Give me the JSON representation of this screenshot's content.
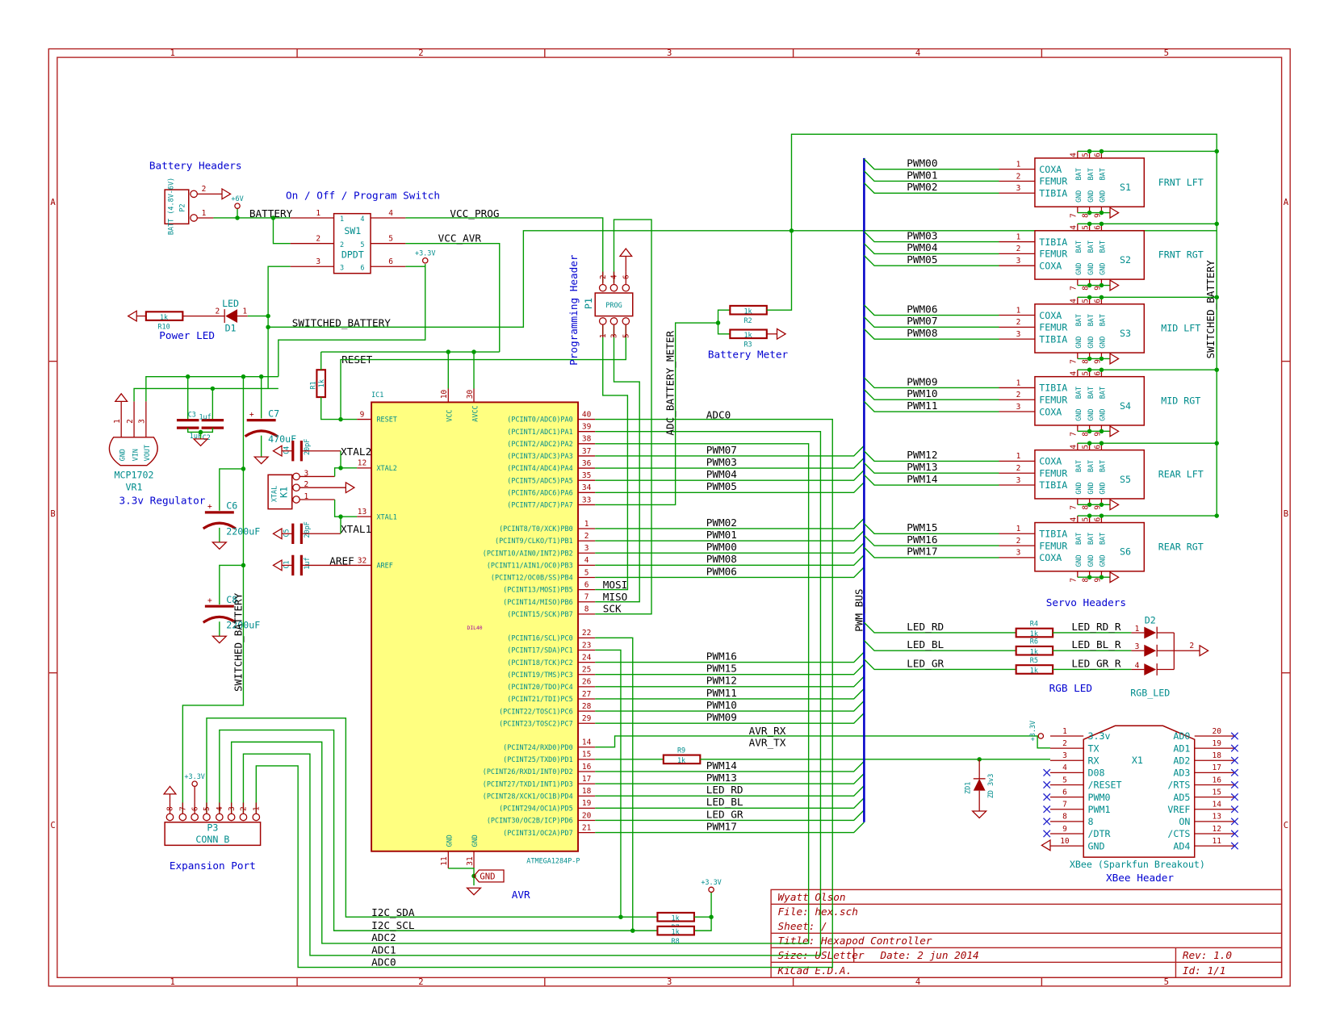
{
  "frame": {
    "cols": [
      "1",
      "2",
      "3",
      "4",
      "5"
    ],
    "rows": [
      "A",
      "B",
      "C"
    ]
  },
  "title_block": {
    "author": "Wyatt Olson",
    "file": "File: hex.sch",
    "sheet": "Sheet: /",
    "title": "Title: Hexapod Controller",
    "size": "Size: USLetter",
    "date": "Date: 2 jun 2014",
    "rev": "Rev: 1.0",
    "tool": "KiCad E.D.A.",
    "id": "Id: 1/1"
  },
  "notes": {
    "battery_headers": "Battery Headers",
    "switch": "On / Off / Program Switch",
    "power_led": "Power LED",
    "regulator": "3.3v Regulator",
    "prog_header": "Programming Header",
    "battery_meter": "Battery Meter",
    "servo_headers": "Servo Headers",
    "rgb_led": "RGB LED",
    "expansion": "Expansion Port",
    "avr": "AVR",
    "xbee": "XBee Header"
  },
  "nets": {
    "battery": "BATTERY",
    "vcc_prog": "VCC_PROG",
    "vcc_avr": "VCC_AVR",
    "switched_battery": "SWITCHED_BATTERY",
    "reset": "RESET",
    "xtal2": "XTAL2",
    "xtal1": "XTAL1",
    "aref": "AREF",
    "adc_battery_meter": "ADC_BATTERY_METER",
    "pwm_bus": "PWM_BUS",
    "i2c_sda": "I2C_SDA",
    "i2c_scl": "I2C_SCL",
    "adc2": "ADC2",
    "adc1": "ADC1",
    "adc0": "ADC0",
    "avr_rx": "AVR_RX",
    "avr_tx": "AVR_TX",
    "gnd": "GND"
  },
  "power": {
    "p6v": "+6V",
    "p33": "+3.3V"
  },
  "components": {
    "p2": {
      "ref": "P2",
      "value": "BATT (4.8V-6V)",
      "pins": [
        "2",
        "1"
      ]
    },
    "sw1": {
      "ref": "SW1",
      "value": "DPDT",
      "pins": [
        "1",
        "2",
        "3",
        "4",
        "5",
        "6"
      ]
    },
    "d1": {
      "ref": "D1",
      "value": "LED",
      "pins": [
        "2",
        "1"
      ]
    },
    "r10": {
      "ref": "R10",
      "value": "1k"
    },
    "r1": {
      "ref": "R1",
      "value": "1k"
    },
    "r2": {
      "ref": "R2",
      "value": "1k"
    },
    "r3": {
      "ref": "R3",
      "value": "1k"
    },
    "r7": {
      "ref": "R7",
      "value": "1k"
    },
    "r8": {
      "ref": "R8",
      "value": "1k"
    },
    "r9": {
      "ref": "R9",
      "value": "1k"
    },
    "vr1": {
      "ref": "VR1",
      "value": "MCP1702",
      "pins": [
        "1",
        "2",
        "3"
      ],
      "pin_names": [
        "GND",
        "VIN",
        "VOUT"
      ]
    },
    "c1": {
      "ref": "C1",
      "value": "1uf"
    },
    "c2": {
      "ref": "C2",
      "value": "1uF"
    },
    "c3": {
      "ref": "C3",
      "value": "1uf"
    },
    "c4": {
      "ref": "C4",
      "value": "20pF"
    },
    "c5": {
      "ref": "C5",
      "value": "20pF"
    },
    "c6": {
      "ref": "C6",
      "value": "2200uF"
    },
    "c7": {
      "ref": "C7",
      "value": "470uF"
    },
    "c8": {
      "ref": "C8",
      "value": "2200uF"
    },
    "k1": {
      "ref": "K1",
      "value": "XTAL",
      "pins": [
        "3",
        "2",
        "1"
      ]
    },
    "p1": {
      "ref": "P1",
      "value": "PROG",
      "pins_top": [
        "2",
        "4",
        "6"
      ],
      "pins_bottom": [
        "1",
        "3",
        "5"
      ]
    },
    "p3": {
      "ref": "P3",
      "value": "CONN_B",
      "pins": [
        "8",
        "7",
        "6",
        "5",
        "4",
        "3",
        "2",
        "1"
      ]
    },
    "zd1": {
      "ref": "ZD1",
      "value": "ZD 3v3"
    },
    "d2": {
      "ref": "D2",
      "value": "RGB_LED",
      "pins": [
        "1",
        "3",
        "4",
        "2"
      ]
    }
  },
  "ic": {
    "ref": "IC1",
    "value": "ATMEGA1284P-P",
    "package": "DIL40",
    "top_pins": [
      {
        "n": "10",
        "name": "VCC"
      },
      {
        "n": "30",
        "name": "AVCC"
      }
    ],
    "bottom_pins": [
      {
        "n": "11",
        "name": "GND"
      },
      {
        "n": "31",
        "name": "GND"
      }
    ],
    "left_pins": [
      {
        "n": "9",
        "name": "RESET"
      },
      {
        "n": "12",
        "name": "XTAL2"
      },
      {
        "n": "13",
        "name": "XTAL1"
      },
      {
        "n": "32",
        "name": "AREF"
      }
    ],
    "right_pins": [
      {
        "n": "40",
        "name": "(PCINT0/ADC0)PA0",
        "net": "ADC0"
      },
      {
        "n": "39",
        "name": "(PCINT1/ADC1)PA1",
        "net": ""
      },
      {
        "n": "38",
        "name": "(PCINT2/ADC2)PA2",
        "net": ""
      },
      {
        "n": "37",
        "name": "(PCINT3/ADC3)PA3",
        "net": "PWM07"
      },
      {
        "n": "36",
        "name": "(PCINT4/ADC4)PA4",
        "net": "PWM03"
      },
      {
        "n": "35",
        "name": "(PCINT5/ADC5)PA5",
        "net": "PWM04"
      },
      {
        "n": "34",
        "name": "(PCINT6/ADC6)PA6",
        "net": "PWM05"
      },
      {
        "n": "33",
        "name": "(PCINT7/ADC7)PA7",
        "net": ""
      },
      {
        "n": "1",
        "name": "(PCINT8/T0/XCK)PB0",
        "net": "PWM02"
      },
      {
        "n": "2",
        "name": "(PCINT9/CLKO/T1)PB1",
        "net": "PWM01"
      },
      {
        "n": "3",
        "name": "(PCINT10/AIN0/INT2)PB2",
        "net": "PWM00"
      },
      {
        "n": "4",
        "name": "(PCINT11/AIN1/OC0)PB3",
        "net": "PWM08"
      },
      {
        "n": "5",
        "name": "(PCINT12/OC0B/SS)PB4",
        "net": "PWM06"
      },
      {
        "n": "6",
        "name": "(PCINT13/MOSI)PB5",
        "net": "MOSI"
      },
      {
        "n": "7",
        "name": "(PCINT14/MISO)PB6",
        "net": "MISO"
      },
      {
        "n": "8",
        "name": "(PCINT15/SCK)PB7",
        "net": "SCK"
      },
      {
        "n": "22",
        "name": "(PCINT16/SCL)PC0",
        "net": ""
      },
      {
        "n": "23",
        "name": "(PCINT17/SDA)PC1",
        "net": ""
      },
      {
        "n": "24",
        "name": "(PCINT18/TCK)PC2",
        "net": "PWM16"
      },
      {
        "n": "25",
        "name": "(PCINT19/TMS)PC3",
        "net": "PWM15"
      },
      {
        "n": "26",
        "name": "(PCINT20/TDO)PC4",
        "net": "PWM12"
      },
      {
        "n": "27",
        "name": "(PCINT21/TDI)PC5",
        "net": "PWM11"
      },
      {
        "n": "28",
        "name": "(PCINT22/TOSC1)PC6",
        "net": "PWM10"
      },
      {
        "n": "29",
        "name": "(PCINT23/TOSC2)PC7",
        "net": "PWM09"
      },
      {
        "n": "14",
        "name": "(PCINT24/RXD0)PD0",
        "net": ""
      },
      {
        "n": "15",
        "name": "(PCINT25/TXD0)PD1",
        "net": ""
      },
      {
        "n": "16",
        "name": "(PCINT26/RXD1/INT0)PD2",
        "net": "PWM14"
      },
      {
        "n": "17",
        "name": "(PCINT27/TXD1/INT1)PD3",
        "net": "PWM13"
      },
      {
        "n": "18",
        "name": "(PCINT28/XCK1/OC1B)PD4",
        "net": "LED_RD"
      },
      {
        "n": "19",
        "name": "(PCINT294/OC1A)PD5",
        "net": "LED_BL"
      },
      {
        "n": "20",
        "name": "(PCINT30/OC2B/ICP)PD6",
        "net": "LED_GR"
      },
      {
        "n": "21",
        "name": "(PCINT31/OC2A)PD7",
        "net": "PWM17"
      }
    ]
  },
  "servos": [
    {
      "ref": "S1",
      "name": "FRNT LFT",
      "joints": [
        "COXA",
        "FEMUR",
        "TIBIA"
      ],
      "nets": [
        "PWM00",
        "PWM01",
        "PWM02"
      ]
    },
    {
      "ref": "S2",
      "name": "FRNT RGT",
      "joints": [
        "TIBIA",
        "FEMUR",
        "COXA"
      ],
      "nets": [
        "PWM03",
        "PWM04",
        "PWM05"
      ]
    },
    {
      "ref": "S3",
      "name": "MID LFT",
      "joints": [
        "COXA",
        "FEMUR",
        "TIBIA"
      ],
      "nets": [
        "PWM06",
        "PWM07",
        "PWM08"
      ]
    },
    {
      "ref": "S4",
      "name": "MID RGT",
      "joints": [
        "TIBIA",
        "FEMUR",
        "COXA"
      ],
      "nets": [
        "PWM09",
        "PWM10",
        "PWM11"
      ]
    },
    {
      "ref": "S5",
      "name": "REAR LFT",
      "joints": [
        "COXA",
        "FEMUR",
        "TIBIA"
      ],
      "nets": [
        "PWM12",
        "PWM13",
        "PWM14"
      ]
    },
    {
      "ref": "S6",
      "name": "REAR RGT",
      "joints": [
        "TIBIA",
        "FEMUR",
        "COXA"
      ],
      "nets": [
        "PWM15",
        "PWM16",
        "PWM17"
      ]
    }
  ],
  "servo_pins": {
    "signal": [
      "1",
      "2",
      "3"
    ],
    "top": [
      "4",
      "5",
      "6"
    ],
    "bottom": [
      "7",
      "8",
      "9"
    ],
    "gnd": "GND",
    "bat": "BAT"
  },
  "rgb": [
    {
      "net": "LED_RD",
      "out": "LED_RD_R",
      "ref": "R4",
      "value": "1k",
      "pin": "1"
    },
    {
      "net": "LED_BL",
      "out": "LED_BL_R",
      "ref": "R6",
      "value": "1k",
      "pin": "3"
    },
    {
      "net": "LED_GR",
      "out": "LED_GR_R",
      "ref": "R5",
      "value": "1k",
      "pin": "4"
    }
  ],
  "xbee": {
    "ref": "X1",
    "value": "XBee (Sparkfun Breakout)",
    "left": [
      {
        "n": "1",
        "name": "3.3v"
      },
      {
        "n": "2",
        "name": "TX"
      },
      {
        "n": "3",
        "name": "RX"
      },
      {
        "n": "4",
        "name": "D08"
      },
      {
        "n": "5",
        "name": "/RESET"
      },
      {
        "n": "6",
        "name": "PWM0"
      },
      {
        "n": "7",
        "name": "PWM1"
      },
      {
        "n": "8",
        "name": "8"
      },
      {
        "n": "9",
        "name": "/DTR"
      },
      {
        "n": "10",
        "name": "GND"
      }
    ],
    "right": [
      {
        "n": "20",
        "name": "AD0"
      },
      {
        "n": "19",
        "name": "AD1"
      },
      {
        "n": "18",
        "name": "AD2"
      },
      {
        "n": "17",
        "name": "AD3"
      },
      {
        "n": "16",
        "name": "/RTS"
      },
      {
        "n": "15",
        "name": "AD5"
      },
      {
        "n": "14",
        "name": "VREF"
      },
      {
        "n": "13",
        "name": "ON"
      },
      {
        "n": "12",
        "name": "/CTS"
      },
      {
        "n": "11",
        "name": "AD4"
      }
    ]
  }
}
